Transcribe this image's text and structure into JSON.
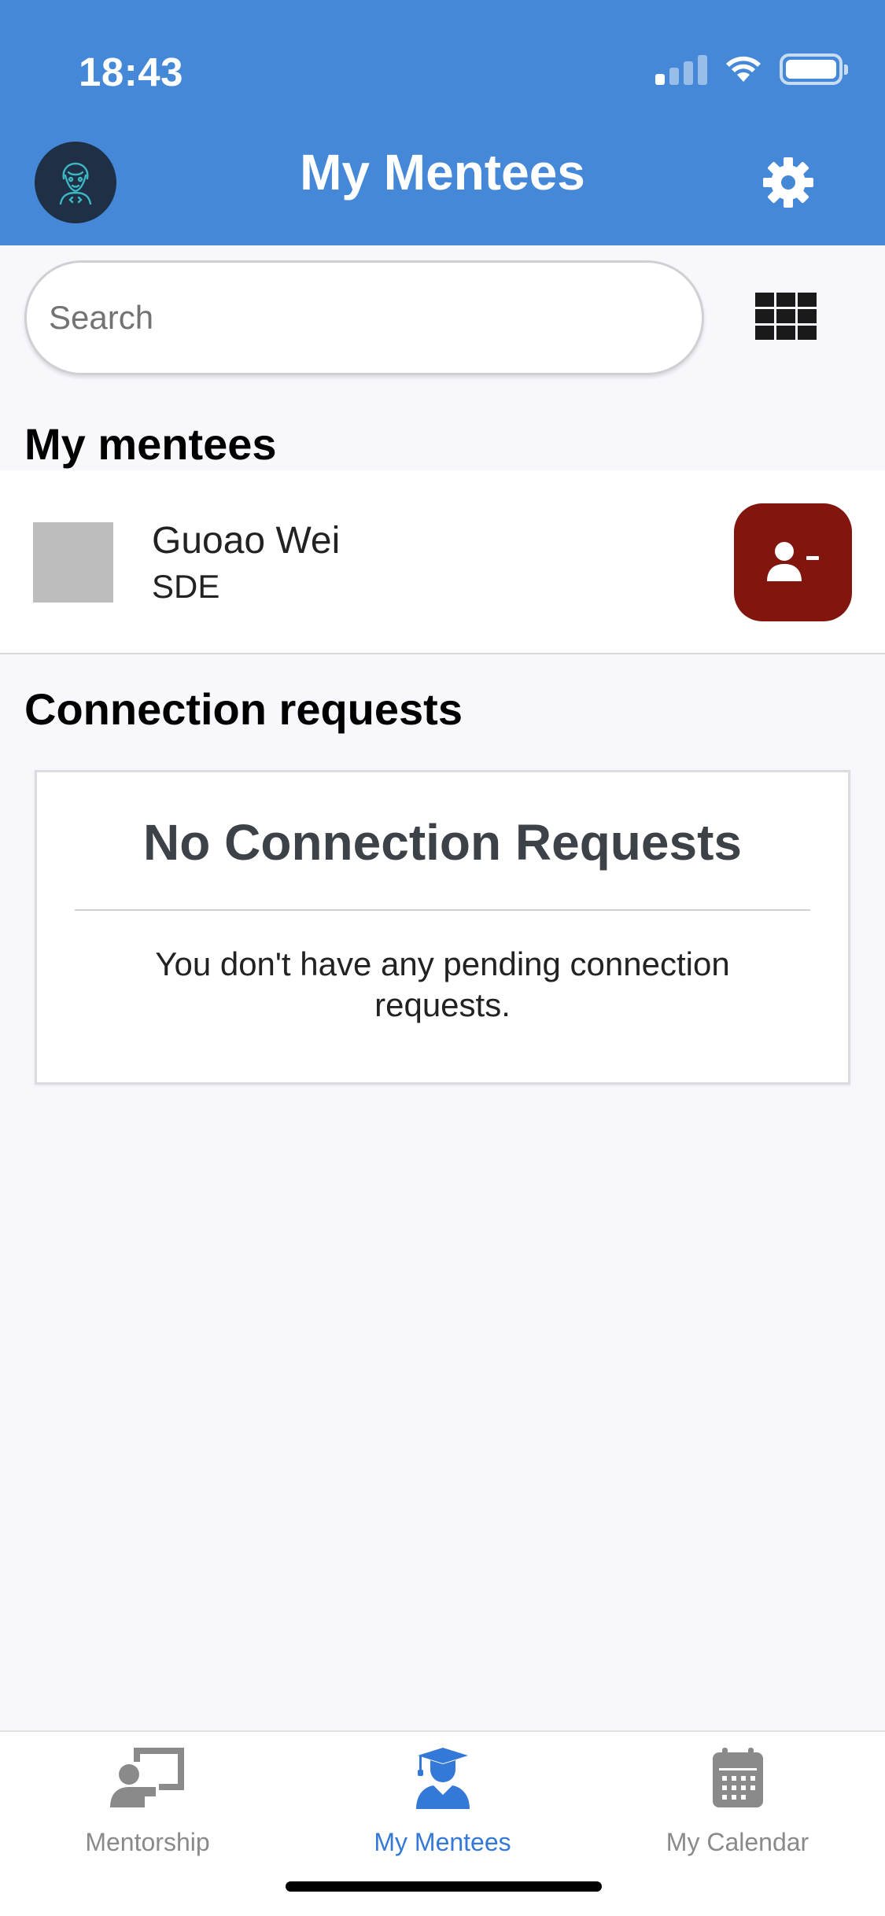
{
  "status_bar": {
    "time": "18:43"
  },
  "header": {
    "title": "My Mentees"
  },
  "search": {
    "placeholder": "Search"
  },
  "mentees_section": {
    "title": "My mentees",
    "items": [
      {
        "name": "Guoao Wei",
        "role": "SDE"
      }
    ]
  },
  "requests_section": {
    "title": "Connection requests",
    "empty_title": "No Connection Requests",
    "empty_text": "You don't have any pending connection requests."
  },
  "tab_bar": {
    "tabs": [
      {
        "label": "Mentorship",
        "icon": "mentorship-icon",
        "active": false
      },
      {
        "label": "My Mentees",
        "icon": "graduate-icon",
        "active": true
      },
      {
        "label": "My Calendar",
        "icon": "calendar-icon",
        "active": false
      }
    ]
  },
  "colors": {
    "header_bg": "#4588d8",
    "remove_button": "#83150f",
    "active_tab": "#3478d8",
    "inactive_tab": "#8a8a8a"
  }
}
